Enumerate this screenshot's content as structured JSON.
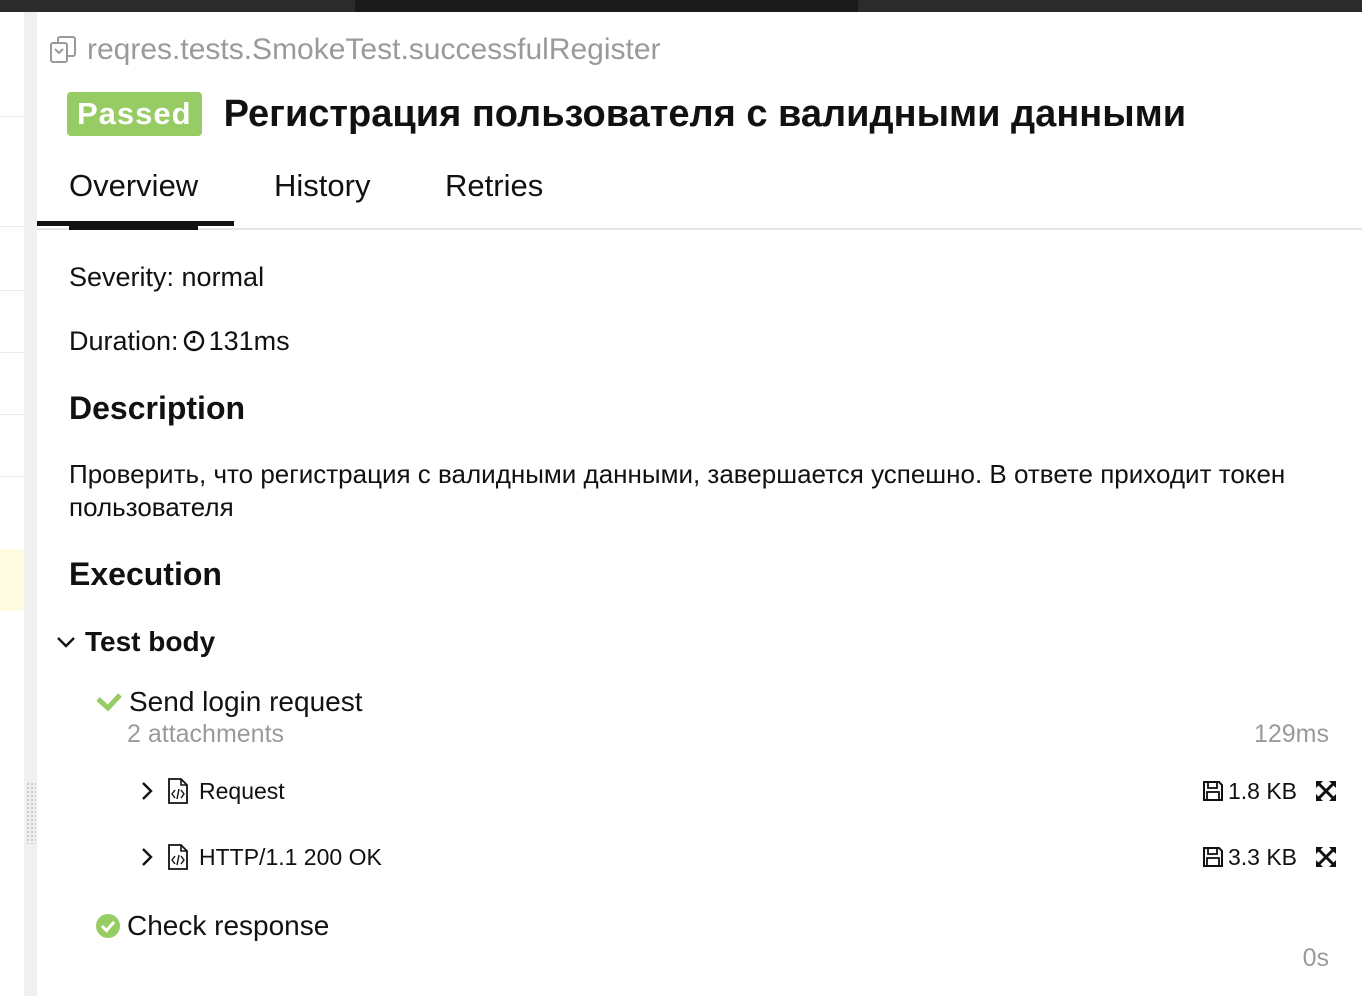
{
  "test": {
    "full_name": "reqres.tests.SmokeTest.successfulRegister",
    "status": "Passed",
    "title": "Регистрация пользователя с валидными данными"
  },
  "tabs": [
    {
      "label": "Overview",
      "active": true
    },
    {
      "label": "History",
      "active": false
    },
    {
      "label": "Retries",
      "active": false
    }
  ],
  "overview": {
    "severity": "Severity: normal",
    "duration_label": "Duration:",
    "duration_value": "131ms",
    "description_heading": "Description",
    "description": "Проверить, что регистрация с валидными данными, завершается успешно. В ответе приходит токен пользователя",
    "execution_heading": "Execution"
  },
  "execution": {
    "test_body_label": "Test body",
    "steps": [
      {
        "label": "Send login request",
        "sub": "2 attachments",
        "duration": "129ms",
        "attachments": [
          {
            "name": "Request",
            "size": "1.8 KB"
          },
          {
            "name": "HTTP/1.1 200 OK",
            "size": "3.3 KB"
          }
        ]
      },
      {
        "label": "Check response",
        "duration": "0s"
      }
    ]
  },
  "colors": {
    "passed": "#97cc64",
    "muted": "#9a9a9a",
    "text": "#111111"
  },
  "icons": [
    "copy-icon",
    "clock-icon",
    "chevron-down-icon",
    "check-icon",
    "check-circle-icon",
    "chevron-right-icon",
    "code-file-icon",
    "save-icon",
    "expand-icon"
  ]
}
